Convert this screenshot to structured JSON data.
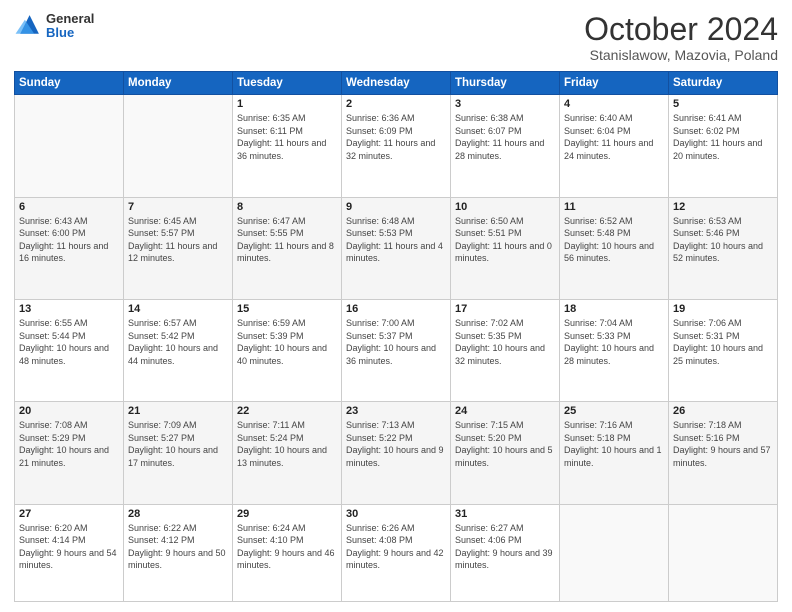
{
  "header": {
    "logo": {
      "line1": "General",
      "line2": "Blue"
    },
    "title": "October 2024",
    "subtitle": "Stanislawow, Mazovia, Poland"
  },
  "weekdays": [
    "Sunday",
    "Monday",
    "Tuesday",
    "Wednesday",
    "Thursday",
    "Friday",
    "Saturday"
  ],
  "weeks": [
    [
      {
        "day": "",
        "sunrise": "",
        "sunset": "",
        "daylight": ""
      },
      {
        "day": "",
        "sunrise": "",
        "sunset": "",
        "daylight": ""
      },
      {
        "day": "1",
        "sunrise": "Sunrise: 6:35 AM",
        "sunset": "Sunset: 6:11 PM",
        "daylight": "Daylight: 11 hours and 36 minutes."
      },
      {
        "day": "2",
        "sunrise": "Sunrise: 6:36 AM",
        "sunset": "Sunset: 6:09 PM",
        "daylight": "Daylight: 11 hours and 32 minutes."
      },
      {
        "day": "3",
        "sunrise": "Sunrise: 6:38 AM",
        "sunset": "Sunset: 6:07 PM",
        "daylight": "Daylight: 11 hours and 28 minutes."
      },
      {
        "day": "4",
        "sunrise": "Sunrise: 6:40 AM",
        "sunset": "Sunset: 6:04 PM",
        "daylight": "Daylight: 11 hours and 24 minutes."
      },
      {
        "day": "5",
        "sunrise": "Sunrise: 6:41 AM",
        "sunset": "Sunset: 6:02 PM",
        "daylight": "Daylight: 11 hours and 20 minutes."
      }
    ],
    [
      {
        "day": "6",
        "sunrise": "Sunrise: 6:43 AM",
        "sunset": "Sunset: 6:00 PM",
        "daylight": "Daylight: 11 hours and 16 minutes."
      },
      {
        "day": "7",
        "sunrise": "Sunrise: 6:45 AM",
        "sunset": "Sunset: 5:57 PM",
        "daylight": "Daylight: 11 hours and 12 minutes."
      },
      {
        "day": "8",
        "sunrise": "Sunrise: 6:47 AM",
        "sunset": "Sunset: 5:55 PM",
        "daylight": "Daylight: 11 hours and 8 minutes."
      },
      {
        "day": "9",
        "sunrise": "Sunrise: 6:48 AM",
        "sunset": "Sunset: 5:53 PM",
        "daylight": "Daylight: 11 hours and 4 minutes."
      },
      {
        "day": "10",
        "sunrise": "Sunrise: 6:50 AM",
        "sunset": "Sunset: 5:51 PM",
        "daylight": "Daylight: 11 hours and 0 minutes."
      },
      {
        "day": "11",
        "sunrise": "Sunrise: 6:52 AM",
        "sunset": "Sunset: 5:48 PM",
        "daylight": "Daylight: 10 hours and 56 minutes."
      },
      {
        "day": "12",
        "sunrise": "Sunrise: 6:53 AM",
        "sunset": "Sunset: 5:46 PM",
        "daylight": "Daylight: 10 hours and 52 minutes."
      }
    ],
    [
      {
        "day": "13",
        "sunrise": "Sunrise: 6:55 AM",
        "sunset": "Sunset: 5:44 PM",
        "daylight": "Daylight: 10 hours and 48 minutes."
      },
      {
        "day": "14",
        "sunrise": "Sunrise: 6:57 AM",
        "sunset": "Sunset: 5:42 PM",
        "daylight": "Daylight: 10 hours and 44 minutes."
      },
      {
        "day": "15",
        "sunrise": "Sunrise: 6:59 AM",
        "sunset": "Sunset: 5:39 PM",
        "daylight": "Daylight: 10 hours and 40 minutes."
      },
      {
        "day": "16",
        "sunrise": "Sunrise: 7:00 AM",
        "sunset": "Sunset: 5:37 PM",
        "daylight": "Daylight: 10 hours and 36 minutes."
      },
      {
        "day": "17",
        "sunrise": "Sunrise: 7:02 AM",
        "sunset": "Sunset: 5:35 PM",
        "daylight": "Daylight: 10 hours and 32 minutes."
      },
      {
        "day": "18",
        "sunrise": "Sunrise: 7:04 AM",
        "sunset": "Sunset: 5:33 PM",
        "daylight": "Daylight: 10 hours and 28 minutes."
      },
      {
        "day": "19",
        "sunrise": "Sunrise: 7:06 AM",
        "sunset": "Sunset: 5:31 PM",
        "daylight": "Daylight: 10 hours and 25 minutes."
      }
    ],
    [
      {
        "day": "20",
        "sunrise": "Sunrise: 7:08 AM",
        "sunset": "Sunset: 5:29 PM",
        "daylight": "Daylight: 10 hours and 21 minutes."
      },
      {
        "day": "21",
        "sunrise": "Sunrise: 7:09 AM",
        "sunset": "Sunset: 5:27 PM",
        "daylight": "Daylight: 10 hours and 17 minutes."
      },
      {
        "day": "22",
        "sunrise": "Sunrise: 7:11 AM",
        "sunset": "Sunset: 5:24 PM",
        "daylight": "Daylight: 10 hours and 13 minutes."
      },
      {
        "day": "23",
        "sunrise": "Sunrise: 7:13 AM",
        "sunset": "Sunset: 5:22 PM",
        "daylight": "Daylight: 10 hours and 9 minutes."
      },
      {
        "day": "24",
        "sunrise": "Sunrise: 7:15 AM",
        "sunset": "Sunset: 5:20 PM",
        "daylight": "Daylight: 10 hours and 5 minutes."
      },
      {
        "day": "25",
        "sunrise": "Sunrise: 7:16 AM",
        "sunset": "Sunset: 5:18 PM",
        "daylight": "Daylight: 10 hours and 1 minute."
      },
      {
        "day": "26",
        "sunrise": "Sunrise: 7:18 AM",
        "sunset": "Sunset: 5:16 PM",
        "daylight": "Daylight: 9 hours and 57 minutes."
      }
    ],
    [
      {
        "day": "27",
        "sunrise": "Sunrise: 6:20 AM",
        "sunset": "Sunset: 4:14 PM",
        "daylight": "Daylight: 9 hours and 54 minutes."
      },
      {
        "day": "28",
        "sunrise": "Sunrise: 6:22 AM",
        "sunset": "Sunset: 4:12 PM",
        "daylight": "Daylight: 9 hours and 50 minutes."
      },
      {
        "day": "29",
        "sunrise": "Sunrise: 6:24 AM",
        "sunset": "Sunset: 4:10 PM",
        "daylight": "Daylight: 9 hours and 46 minutes."
      },
      {
        "day": "30",
        "sunrise": "Sunrise: 6:26 AM",
        "sunset": "Sunset: 4:08 PM",
        "daylight": "Daylight: 9 hours and 42 minutes."
      },
      {
        "day": "31",
        "sunrise": "Sunrise: 6:27 AM",
        "sunset": "Sunset: 4:06 PM",
        "daylight": "Daylight: 9 hours and 39 minutes."
      },
      {
        "day": "",
        "sunrise": "",
        "sunset": "",
        "daylight": ""
      },
      {
        "day": "",
        "sunrise": "",
        "sunset": "",
        "daylight": ""
      }
    ]
  ]
}
